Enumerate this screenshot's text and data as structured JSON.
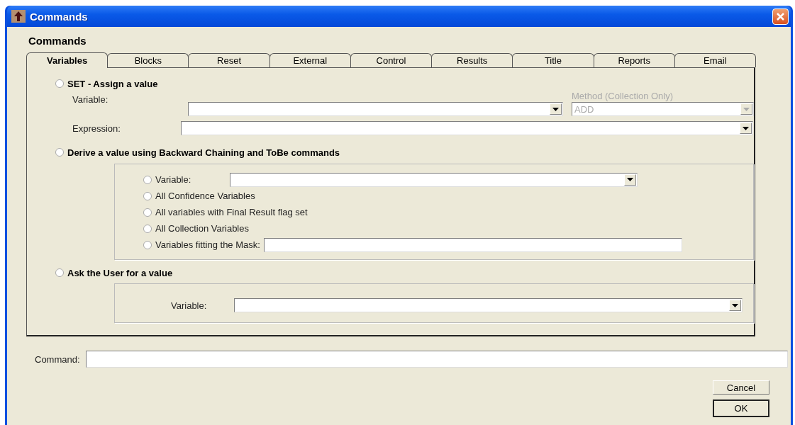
{
  "window": {
    "title": "Commands"
  },
  "heading": "Commands",
  "tabs": [
    {
      "label": "Variables",
      "selected": true
    },
    {
      "label": "Blocks",
      "selected": false
    },
    {
      "label": "Reset",
      "selected": false
    },
    {
      "label": "External",
      "selected": false
    },
    {
      "label": "Control",
      "selected": false
    },
    {
      "label": "Results",
      "selected": false
    },
    {
      "label": "Title",
      "selected": false
    },
    {
      "label": "Reports",
      "selected": false
    },
    {
      "label": "Email",
      "selected": false
    }
  ],
  "set_section": {
    "label": "SET - Assign a value",
    "selected": false,
    "variable_label": "Variable:",
    "method": {
      "label": "Method (Collection Only)",
      "value": "ADD",
      "disabled": true
    },
    "expression_label": "Expression:"
  },
  "derive_section": {
    "label": "Derive a value using Backward Chaining and ToBe commands",
    "selected": false,
    "options": [
      {
        "kind": "dropdown",
        "label": "Variable:",
        "selected": false
      },
      {
        "kind": "plain",
        "label": "All Confidence Variables",
        "selected": false
      },
      {
        "kind": "plain",
        "label": "All variables with Final Result flag set",
        "selected": false
      },
      {
        "kind": "plain",
        "label": "All Collection Variables",
        "selected": false
      },
      {
        "kind": "text",
        "label": "Variables fitting the Mask:",
        "selected": false
      }
    ]
  },
  "ask_section": {
    "label": "Ask the User for a value",
    "selected": false,
    "variable_label": "Variable:"
  },
  "command": {
    "label": "Command:"
  },
  "buttons": [
    {
      "label": "Cancel",
      "default": false
    },
    {
      "label": "OK",
      "default": true
    }
  ]
}
